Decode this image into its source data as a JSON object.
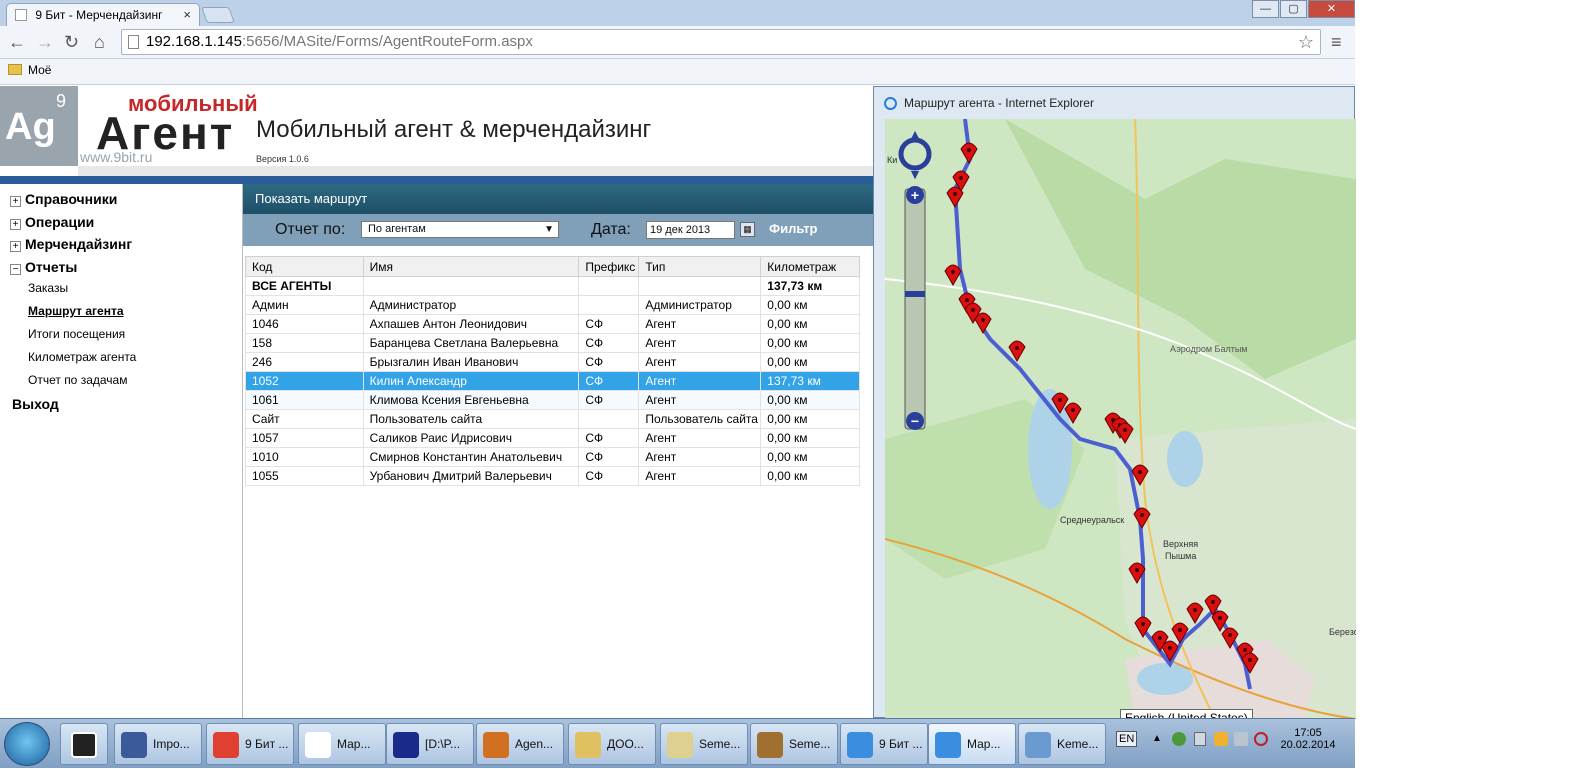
{
  "browser": {
    "tab_title": "9 Бит - Мерчендайзинг",
    "tab_close": "×",
    "url_host": "192.168.1.145",
    "url_rest": ":5656/MASite/Forms/AgentRouteForm.aspx",
    "bookmark": "Моё",
    "window_buttons": [
      "—",
      "▢",
      "✕"
    ]
  },
  "header": {
    "logo_ag": "Ag",
    "logo_nine": "9",
    "logo_mobile": "мобильный",
    "logo_agent": "Агент",
    "logo_site": "www.9bit.ru",
    "title": "Мобильный агент & мерчендайзинг",
    "version": "Версия 1.0.6"
  },
  "sidebar": {
    "groups": [
      {
        "label": "Справочники",
        "toggle": "+"
      },
      {
        "label": "Операции",
        "toggle": "+"
      },
      {
        "label": "Мерчендайзинг",
        "toggle": "+"
      },
      {
        "label": "Отчеты",
        "toggle": "−"
      }
    ],
    "subitems": [
      "Заказы",
      "Маршрут агента",
      "Итоги посещения",
      "Километраж агента",
      "Отчет по задачам"
    ],
    "exit": "Выход"
  },
  "content": {
    "header": "Показать маршрут",
    "filter": {
      "report_label": "Отчет по:",
      "report_value": "По агентам",
      "date_label": "Дата:",
      "date_value": "19 дек 2013",
      "filter_button": "Фильтр"
    },
    "table": {
      "columns": [
        "Код",
        "Имя",
        "Префикс",
        "Тип",
        "Километраж"
      ],
      "rows": [
        [
          "ВСЕ АГЕНТЫ",
          "",
          "",
          "",
          "137,73 км"
        ],
        [
          "Админ",
          "Администратор",
          "",
          "Администратор",
          "0,00 км"
        ],
        [
          "1046",
          "Ахпашев Антон Леонидович",
          "СФ",
          "Агент",
          "0,00 км"
        ],
        [
          "158",
          "Баранцева Светлана Валерьевна",
          "СФ",
          "Агент",
          "0,00 км"
        ],
        [
          "246",
          "Брызгалин Иван Иванович",
          "СФ",
          "Агент",
          "0,00 км"
        ],
        [
          "1052",
          "Килин Александр",
          "СФ",
          "Агент",
          "137,73 км"
        ],
        [
          "1061",
          "Климова Ксения Евгеньевна",
          "СФ",
          "Агент",
          "0,00 км"
        ],
        [
          "Сайт",
          "Пользователь сайта",
          "",
          "Пользователь сайта",
          "0,00 км"
        ],
        [
          "1057",
          "Саликов Раис Идрисович",
          "СФ",
          "Агент",
          "0,00 км"
        ],
        [
          "1010",
          "Смирнов Константин Анатольевич",
          "СФ",
          "Агент",
          "0,00 км"
        ],
        [
          "1055",
          "Урбанович Дмитрий Валерьевич",
          "СФ",
          "Агент",
          "0,00 км"
        ]
      ]
    }
  },
  "popup": {
    "title": "Маршрут агента - Internet Explorer",
    "map_labels": [
      "Аэродром Балтым",
      "Среднеуральск",
      "Верхняя",
      "Пышма",
      "Березо",
      "Ки"
    ]
  },
  "taskbar": {
    "buttons": [
      "Impo...",
      "9 Бит ...",
      "Мар...",
      "[D:\\P...",
      "Agen...",
      "ДОО...",
      "Seme...",
      "Seme...",
      "9 Бит ...",
      "Мар...",
      "Keme..."
    ],
    "lang": "EN",
    "tooltip": "English (United States)",
    "time": "17:05",
    "date": "20.02.2014"
  },
  "colors": {
    "accent": "#33a3e8",
    "header_bar": "#2c5b9a",
    "route": "#4b5fd0",
    "marker": "#d81010"
  }
}
